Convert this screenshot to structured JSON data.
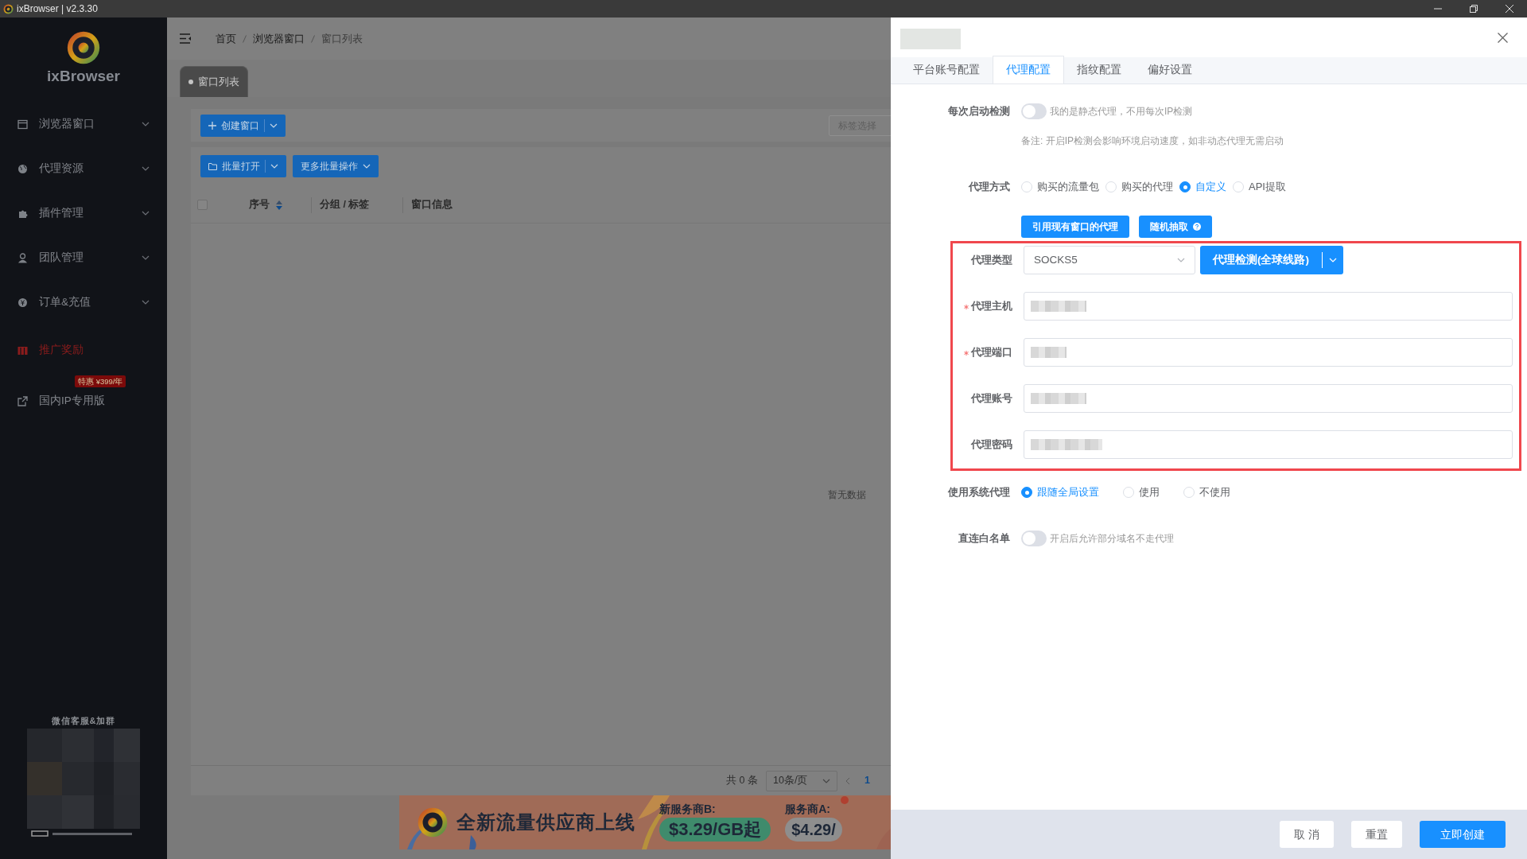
{
  "window": {
    "title": "ixBrowser | v2.3.30"
  },
  "sidebar": {
    "logo": "ixBrowser",
    "items": [
      {
        "label": "浏览器窗口",
        "kind": "submenu"
      },
      {
        "label": "代理资源",
        "kind": "submenu"
      },
      {
        "label": "插件管理",
        "kind": "submenu"
      },
      {
        "label": "团队管理",
        "kind": "submenu"
      },
      {
        "label": "订单&充值",
        "kind": "submenu"
      },
      {
        "label": "推广奖励",
        "kind": "promo"
      },
      {
        "label": "国内IP专用版",
        "kind": "external",
        "badge": "特惠 ¥399/年"
      }
    ],
    "qr_caption": "微信客服&加群"
  },
  "breadcrumb": [
    {
      "label": "首页",
      "current": false
    },
    {
      "label": "浏览器窗口",
      "current": false
    },
    {
      "label": "窗口列表",
      "current": true
    }
  ],
  "page_tabs": [
    {
      "label": "窗口列表",
      "selected": true
    }
  ],
  "toolbar": {
    "create": "创建窗口",
    "tag_placeholder": "标签选择",
    "batch_open": "批量打开",
    "more_batch": "更多批量操作"
  },
  "table": {
    "select_all_checked": false,
    "columns": [
      "序号",
      "分组 / 标签",
      "窗口信息"
    ],
    "empty_text": "暂无数据"
  },
  "pagination": {
    "total": "共 0 条",
    "page_size": "10条/页",
    "pages": [
      {
        "label": "1",
        "selected": true
      }
    ]
  },
  "banner": {
    "headline": "全新流量供应商上线",
    "offers": [
      {
        "label": "新服务商B:",
        "price": "$3.29/GB起",
        "kind": "new"
      },
      {
        "label": "服务商A:",
        "price": "$4.29/",
        "kind": "old"
      }
    ]
  },
  "drawer": {
    "tabs": [
      {
        "label": "平台账号配置",
        "selected": false
      },
      {
        "label": "代理配置",
        "selected": true
      },
      {
        "label": "指纹配置",
        "selected": false
      },
      {
        "label": "偏好设置",
        "selected": false
      }
    ],
    "startup_check": {
      "label": "每次启动检测",
      "on": false,
      "hint": "我的是静态代理，不用每次IP检测",
      "note": "备注: 开启IP检测会影响环境启动速度，如非动态代理无需启动"
    },
    "proxy_mode": {
      "label": "代理方式",
      "options": [
        {
          "label": "购买的流量包",
          "selected": false
        },
        {
          "label": "购买的代理",
          "selected": false
        },
        {
          "label": "自定义",
          "selected": true
        },
        {
          "label": "API提取",
          "selected": false
        }
      ]
    },
    "proxy_actions": [
      {
        "label": "引用现有窗口的代理",
        "help": false
      },
      {
        "label": "随机抽取",
        "help": true
      }
    ],
    "proxy_type": {
      "label": "代理类型",
      "value": "SOCKS5",
      "check_button": "代理检测(全球线路)"
    },
    "fields": [
      {
        "label": "代理主机",
        "required": true
      },
      {
        "label": "代理端口",
        "required": true
      },
      {
        "label": "代理账号",
        "required": false
      },
      {
        "label": "代理密码",
        "required": false
      }
    ],
    "system_proxy": {
      "label": "使用系统代理",
      "options": [
        {
          "label": "跟随全局设置",
          "selected": true
        },
        {
          "label": "使用",
          "selected": false
        },
        {
          "label": "不使用",
          "selected": false
        }
      ]
    },
    "whitelist": {
      "label": "直连白名单",
      "on": false,
      "hint": "开启后允许部分域名不走代理"
    }
  },
  "footer_buttons": [
    {
      "label": "取 消",
      "kind": "default"
    },
    {
      "label": "重置",
      "kind": "default"
    },
    {
      "label": "立即创建",
      "kind": "primary"
    }
  ]
}
